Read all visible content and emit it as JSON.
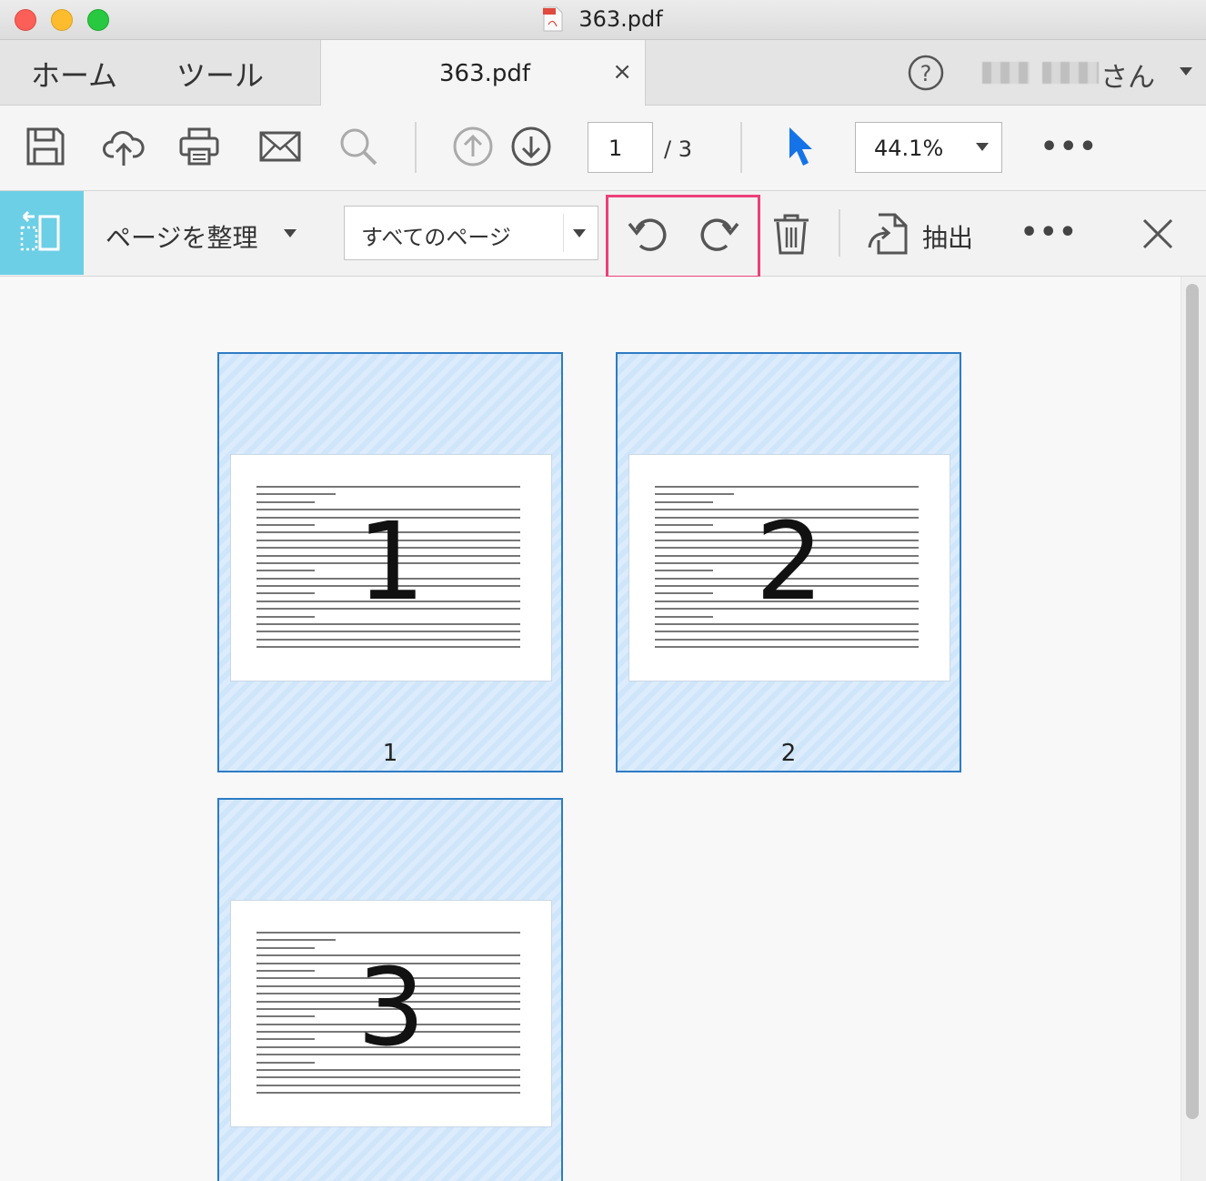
{
  "window": {
    "title": "363.pdf",
    "file_icon": "pdf-file-icon"
  },
  "tabs": {
    "home_label": "ホーム",
    "tools_label": "ツール",
    "document_tab_label": "363.pdf",
    "close_glyph": "×",
    "help_icon": "question-circle-icon",
    "user_suffix": "さん"
  },
  "toolbar": {
    "icons": [
      "save-icon",
      "cloud-upload-icon",
      "print-icon",
      "email-icon",
      "search-icon",
      "page-up-icon",
      "page-down-icon",
      "select-pointer-icon"
    ],
    "page_current": "1",
    "page_total": "/ 3",
    "zoom_value": "44.1%",
    "more_glyph": "•••"
  },
  "organize": {
    "label": "ページを整理",
    "page_range_value": "すべてのページ",
    "extract_label": "抽出",
    "more_glyph": "•••",
    "close_glyph": "×",
    "accent_color": "#6ccfe5",
    "highlight_color": "#ec407a"
  },
  "pages": [
    {
      "number": "1",
      "label": "1"
    },
    {
      "number": "2",
      "label": "2"
    },
    {
      "number": "3",
      "label": "3"
    }
  ]
}
